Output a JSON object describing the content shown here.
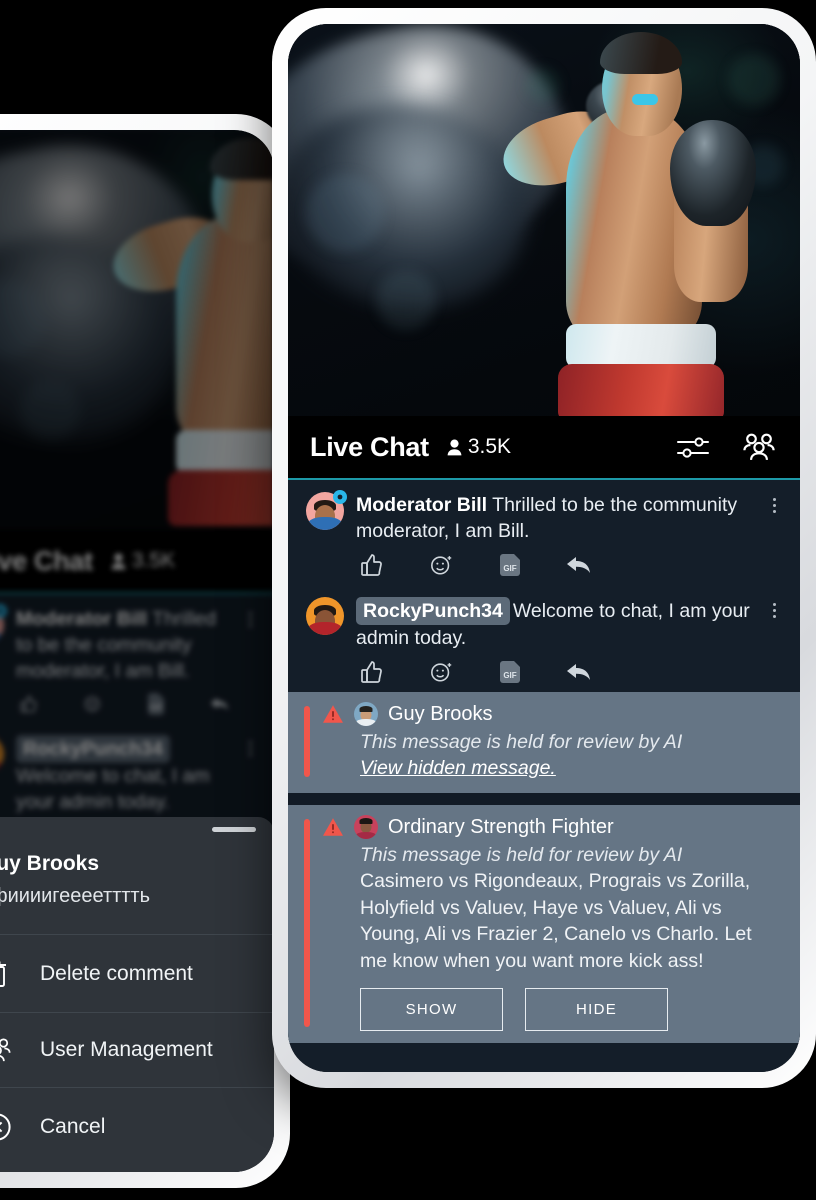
{
  "header": {
    "title": "Live Chat",
    "viewer_count": "3.5K",
    "viewer_icon": "person-icon",
    "settings_icon": "sliders-icon",
    "members_icon": "people-group-icon",
    "accent_color": "#1d9aa8"
  },
  "messages": [
    {
      "name": "Moderator Bill",
      "name_style": "plain",
      "text": "Thrilled to be the community moderator, I am Bill.",
      "avatar_bg": "#f2a6a0",
      "badge": "gear-icon",
      "actions": [
        "thumbs-up-icon",
        "emoji-icon",
        "gif-icon",
        "reply-icon"
      ],
      "kebab": "more-options-icon"
    },
    {
      "name": "RockyPunch34",
      "name_style": "chip",
      "text": "Welcome to chat, I am your admin today.",
      "avatar_bg": "#f0962a",
      "badge": null,
      "actions": [
        "thumbs-up-icon",
        "emoji-icon",
        "gif-icon",
        "reply-icon"
      ],
      "kebab": "more-options-icon"
    }
  ],
  "held_messages": [
    {
      "name": "Guy Brooks",
      "warning_icon": "warning-triangle-icon",
      "notice": "This message is held for review by AI",
      "link": "View hidden message.",
      "body": null,
      "avatar_bg": "#8fb4c9",
      "buttons": []
    },
    {
      "name": "Ordinary Strength Fighter",
      "warning_icon": "warning-triangle-icon",
      "notice": "This message is held for review by AI",
      "link": null,
      "body": "Casimero vs Rigondeaux, Prograis vs Zorilla, Holyfield vs Valuev, Haye vs Valuev, Ali vs Young, Ali vs Frazier 2, Canelo vs Charlo. Let me know when you want more kick ass!",
      "avatar_bg": "#c8425c",
      "buttons": [
        "SHOW",
        "HIDE"
      ]
    }
  ],
  "held_style": {
    "background": "#657585",
    "accent_bar": "#f1564b"
  },
  "action_sheet": {
    "user_name": "Guy Brooks",
    "user_message": "афиииигеееетттть",
    "rows": [
      {
        "label": "Delete comment",
        "icon": "trash-icon"
      },
      {
        "label": "User Management",
        "icon": "people-group-icon"
      },
      {
        "label": "Cancel",
        "icon": "close-circle-icon"
      }
    ],
    "background": "#2f343a"
  },
  "hero": {
    "alt": "boxer-photo",
    "description": "Boxer in red shorts with black gloves under teal lighting"
  },
  "theme": {
    "page_background": "#000000",
    "chat_background": "#141e29",
    "header_background": "#000000",
    "phone_frame": "#ffffff"
  }
}
